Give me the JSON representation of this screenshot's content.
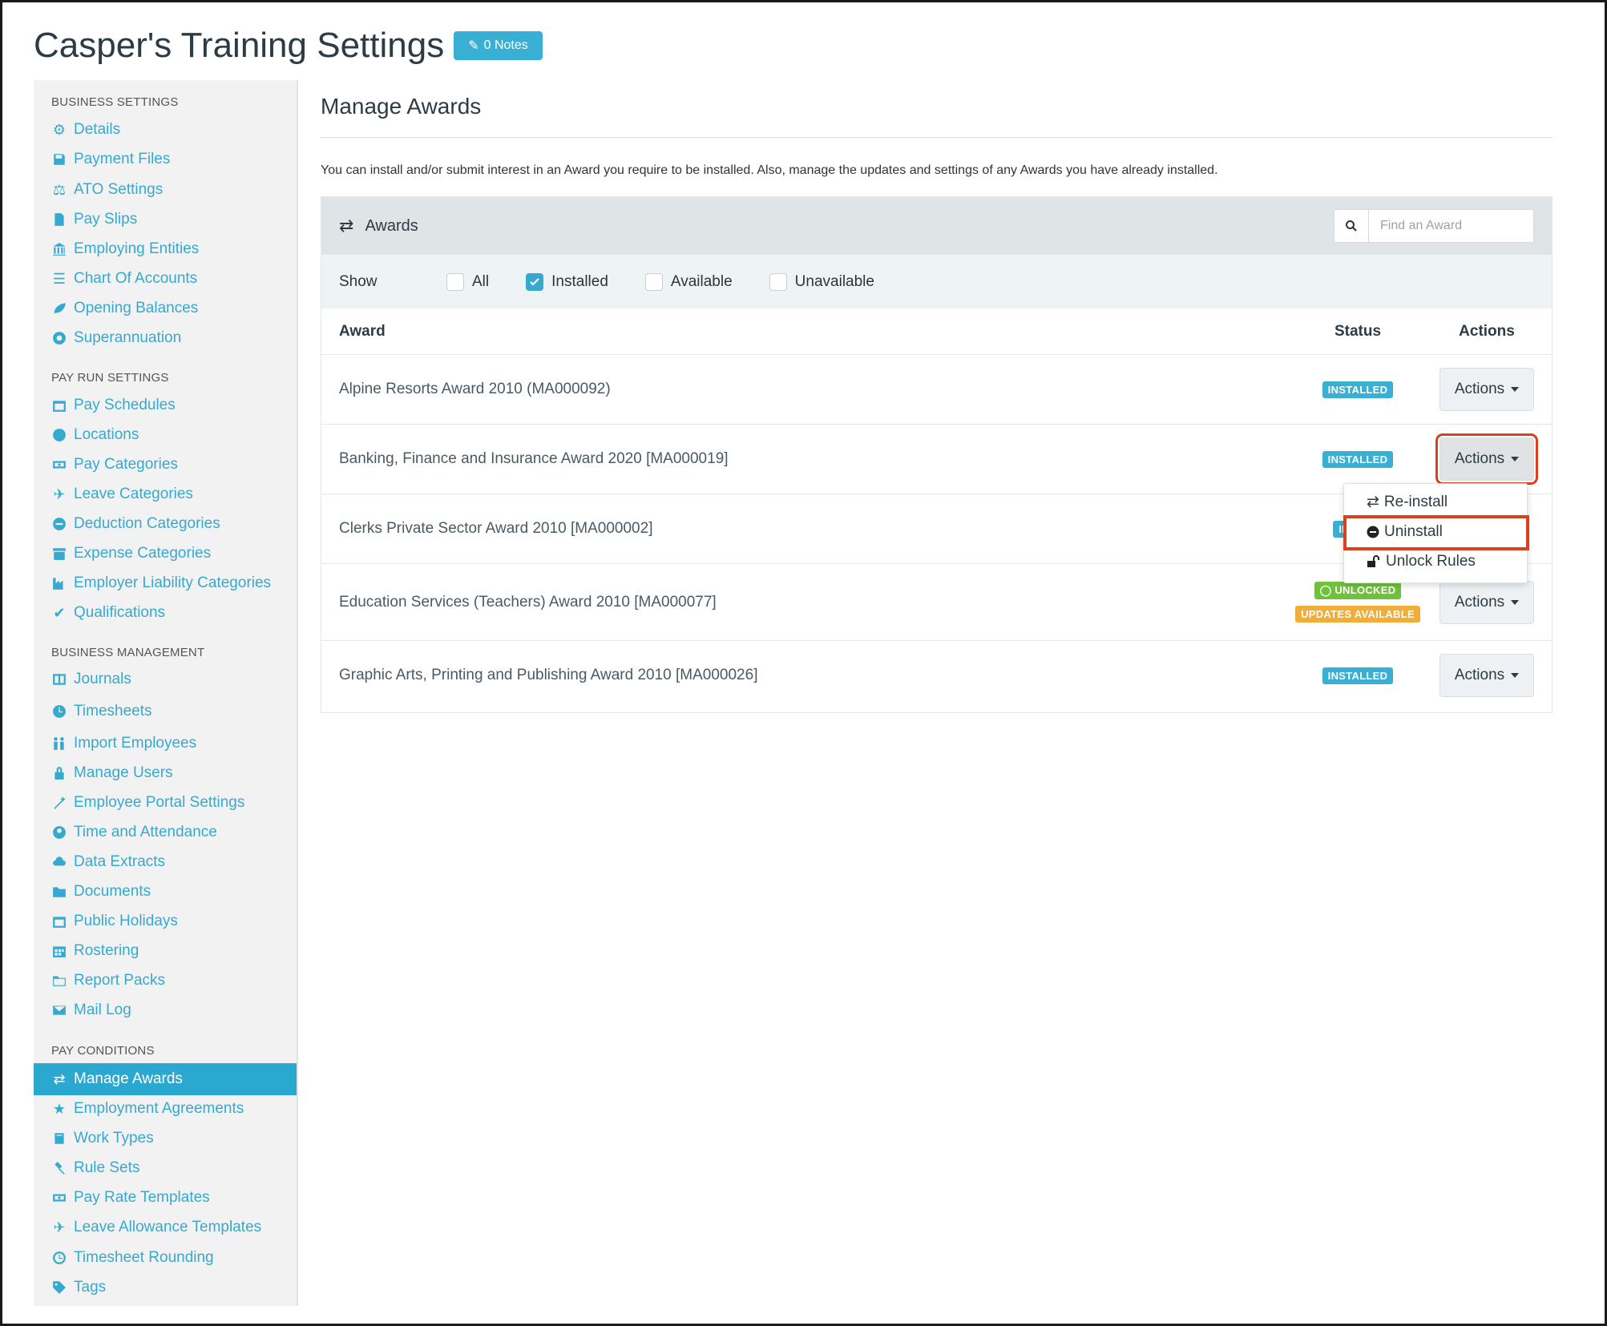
{
  "page": {
    "title": "Casper's Training Settings",
    "notes_label": "0 Notes"
  },
  "sidebar": {
    "sections": [
      {
        "label": "BUSINESS SETTINGS"
      },
      {
        "label": "PAY RUN SETTINGS"
      },
      {
        "label": "BUSINESS MANAGEMENT"
      },
      {
        "label": "PAY CONDITIONS"
      }
    ],
    "items": [
      {
        "label": "Details",
        "icon": "gear-icon"
      },
      {
        "label": "Payment Files",
        "icon": "save-icon"
      },
      {
        "label": "ATO Settings",
        "icon": "scale-icon"
      },
      {
        "label": "Pay Slips",
        "icon": "file-icon"
      },
      {
        "label": "Employing Entities",
        "icon": "bank-icon"
      },
      {
        "label": "Chart Of Accounts",
        "icon": "list-icon"
      },
      {
        "label": "Opening Balances",
        "icon": "leaf-icon"
      },
      {
        "label": "Superannuation",
        "icon": "lifebuoy-icon"
      },
      {
        "label": "Pay Schedules",
        "icon": "calendar-icon"
      },
      {
        "label": "Locations",
        "icon": "globe-icon"
      },
      {
        "label": "Pay Categories",
        "icon": "money-icon"
      },
      {
        "label": "Leave Categories",
        "icon": "plane-icon"
      },
      {
        "label": "Deduction Categories",
        "icon": "minus-circle-icon"
      },
      {
        "label": "Expense Categories",
        "icon": "archive-icon"
      },
      {
        "label": "Employer Liability Categories",
        "icon": "industry-icon"
      },
      {
        "label": "Qualifications",
        "icon": "check-icon"
      },
      {
        "label": "Journals",
        "icon": "columns-icon"
      },
      {
        "label": "Timesheets",
        "icon": "clock-icon"
      },
      {
        "label": "Import Employees",
        "icon": "users-icon"
      },
      {
        "label": "Manage Users",
        "icon": "lock-icon"
      },
      {
        "label": "Employee Portal Settings",
        "icon": "magic-wand-icon"
      },
      {
        "label": "Time and Attendance",
        "icon": "time-attendance-icon"
      },
      {
        "label": "Data Extracts",
        "icon": "cloud-download-icon"
      },
      {
        "label": "Documents",
        "icon": "folder-icon"
      },
      {
        "label": "Public Holidays",
        "icon": "calendar-icon"
      },
      {
        "label": "Rostering",
        "icon": "calendar-grid-icon"
      },
      {
        "label": "Report Packs",
        "icon": "folder-open-icon"
      },
      {
        "label": "Mail Log",
        "icon": "envelope-icon"
      },
      {
        "label": "Manage Awards",
        "icon": "exchange-icon",
        "active": true
      },
      {
        "label": "Employment Agreements",
        "icon": "star-icon"
      },
      {
        "label": "Work Types",
        "icon": "book-icon"
      },
      {
        "label": "Rule Sets",
        "icon": "gavel-icon"
      },
      {
        "label": "Pay Rate Templates",
        "icon": "money-icon"
      },
      {
        "label": "Leave Allowance Templates",
        "icon": "plane-icon"
      },
      {
        "label": "Timesheet Rounding",
        "icon": "clock-icon"
      },
      {
        "label": "Tags",
        "icon": "tag-icon"
      }
    ]
  },
  "main": {
    "heading": "Manage Awards",
    "description": "You can install and/or submit interest in an Award you require to be installed. Also, manage the updates and settings of any Awards you have already installed.",
    "panel_title": "Awards",
    "search_placeholder": "Find an Award",
    "filter": {
      "show_label": "Show",
      "options": [
        {
          "label": "All",
          "checked": false
        },
        {
          "label": "Installed",
          "checked": true
        },
        {
          "label": "Available",
          "checked": false
        },
        {
          "label": "Unavailable",
          "checked": false
        }
      ]
    },
    "columns": {
      "award": "Award",
      "status": "Status",
      "actions": "Actions"
    },
    "rows": [
      {
        "award": "Alpine Resorts Award 2010 (MA000092)",
        "status": [
          "INSTALLED"
        ],
        "action": "Actions"
      },
      {
        "award": "Banking, Finance and Insurance Award 2020 [MA000019]",
        "status": [
          "INSTALLED"
        ],
        "action": "Actions"
      },
      {
        "award": "Clerks Private Sector Award 2010 [MA000002]",
        "status": [
          "INSTAL"
        ],
        "action": "Actions"
      },
      {
        "award": "Education Services (Teachers) Award 2010 [MA000077]",
        "status": [
          "UNLOCKED",
          "UPDATES AVAILABLE"
        ],
        "action": "Actions"
      },
      {
        "award": "Graphic Arts, Printing and Publishing Award 2010 [MA000026]",
        "status": [
          "INSTALLED"
        ],
        "action": "Actions"
      }
    ],
    "dropdown": [
      {
        "label": "Re-install",
        "icon": "exchange-icon"
      },
      {
        "label": "Uninstall",
        "icon": "minus-circle-icon"
      },
      {
        "label": "Unlock Rules",
        "icon": "unlock-icon"
      }
    ]
  },
  "colors": {
    "accent": "#36a9cf",
    "highlight": "#d8401e",
    "installed": "#39b0d3",
    "unlocked": "#6fc13a",
    "updates": "#f0ad38"
  }
}
